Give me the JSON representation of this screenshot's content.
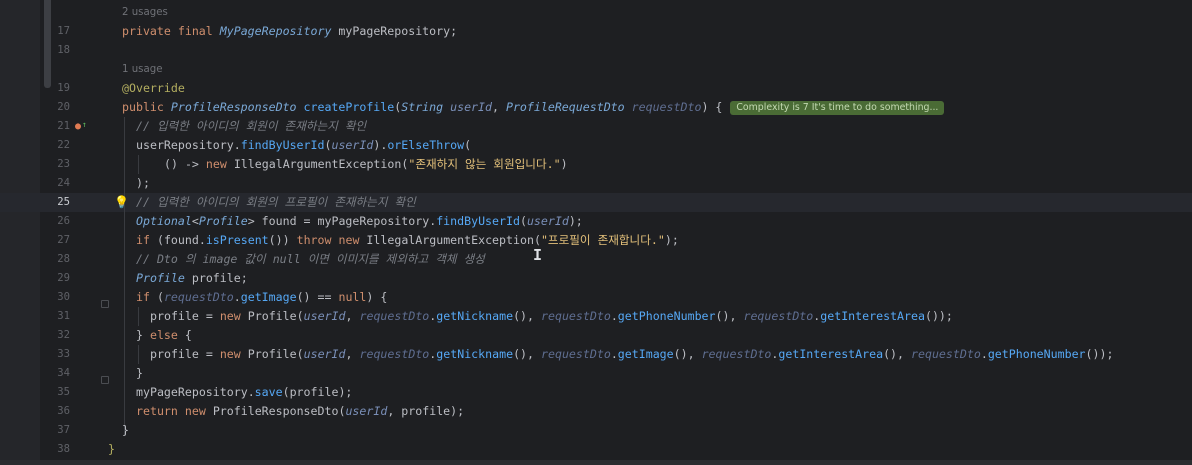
{
  "editor": {
    "active_line": "25",
    "lines": [
      {
        "n": "",
        "hint": "2 usages"
      },
      {
        "n": "17"
      },
      {
        "n": "18"
      },
      {
        "n": "",
        "hint": "1 usage"
      },
      {
        "n": "19"
      },
      {
        "n": "20"
      },
      {
        "n": "21"
      },
      {
        "n": "22"
      },
      {
        "n": "23"
      },
      {
        "n": "24"
      },
      {
        "n": "25"
      },
      {
        "n": "26"
      },
      {
        "n": "27"
      },
      {
        "n": "28"
      },
      {
        "n": "29"
      },
      {
        "n": "30"
      },
      {
        "n": "31"
      },
      {
        "n": "32"
      },
      {
        "n": "33"
      },
      {
        "n": "34"
      },
      {
        "n": "35"
      },
      {
        "n": "36"
      },
      {
        "n": "37"
      },
      {
        "n": "38"
      }
    ],
    "inlay_hint": "Complexity is 7 It's time to do something...",
    "tokens": {
      "private": "private",
      "final": "final",
      "MyPageRepository": "MyPageRepository",
      "myPageRepositoryField": "myPageRepository",
      "semi": ";",
      "override": "@Override",
      "public": "public",
      "ProfileResponseDto": "ProfileResponseDto",
      "createProfile": "createProfile",
      "lp": "(",
      "String": "String",
      "userId": "userId",
      "comma": ", ",
      "ProfileRequestDto": "ProfileRequestDto",
      "requestDto": "requestDto",
      "rpBrace": ") {",
      "c21": "// 입력한 아이디의 회원이 존재하는지 확인",
      "userRepository": "userRepository",
      "dot": ".",
      "findByUserId": "findByUserId",
      "orElseThrow": "orElseThrow",
      "lpOnly": "(",
      "arrow": "() -> ",
      "new": "new",
      "IAE": "IllegalArgumentException",
      "s23": "\"존재하지 않는 회원입니다.\"",
      "rp": ")",
      "closeParenSemi": ");",
      "c25": "// 입력한 아이디의 회원의 프로필이 존재하는지 확인",
      "Optional": "Optional",
      "lt": "<",
      "Profile": "Profile",
      "gt": ">",
      "found": " found = ",
      "myPageRepository": "myPageRepository",
      "rpSemi": ");",
      "if": "if",
      "found2": "found",
      "isPresent": "isPresent",
      "emptyCall": "()",
      "throw": "throw",
      "s27": "\"프로필이 존재합니다.\"",
      "c28": "// Dto 의 image 값이 null 이면 이미지를 제외하고 객체 생성",
      "profileDecl": " profile;",
      "getImage": "getImage",
      "eqNull": " == ",
      "null": "null",
      "rpBraceOnly": ") {",
      "profile": "profile",
      "assign": " = ",
      "getNickname": "getNickname",
      "getPhoneNumber": "getPhoneNumber",
      "getInterestArea": "getInterestArea",
      "dblRpSemi": "());",
      "elseLine": "} ",
      "else": "else",
      "openBrace": " {",
      "closeBrace": "}",
      "save": "save",
      "return": "return"
    }
  }
}
